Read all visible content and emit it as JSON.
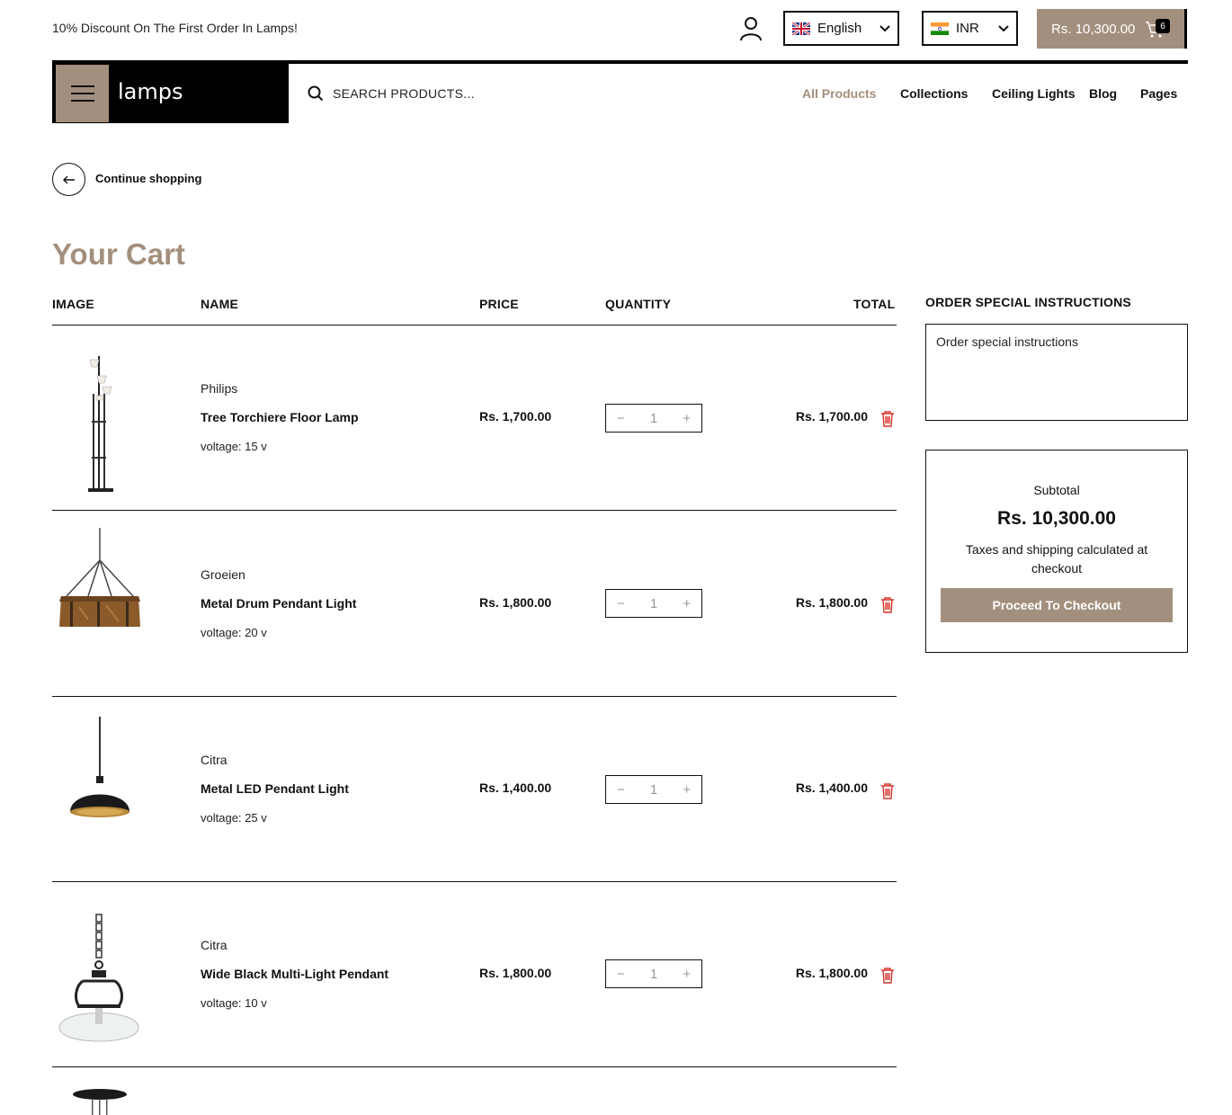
{
  "topbar": {
    "promo": "10% Discount On The First Order In Lamps!",
    "language": "English",
    "currency": "INR",
    "cart_total": "Rs. 10,300.00",
    "cart_count": "6"
  },
  "header": {
    "brand": "lamps",
    "search_placeholder": "SEARCH PRODUCTS...",
    "nav": [
      "All Products",
      "Collections",
      "Ceiling Lights",
      "Blog",
      "Pages"
    ]
  },
  "back_label": "Continue shopping",
  "page_title": "Your Cart",
  "table": {
    "headers": [
      "IMAGE",
      "NAME",
      "PRICE",
      "QUANTITY",
      "TOTAL"
    ],
    "rows": [
      {
        "vendor": "Philips",
        "name": "Tree Torchiere Floor Lamp",
        "option": "voltage:  15 v",
        "price": "Rs. 1,700.00",
        "qty": "1",
        "total": "Rs. 1,700.00"
      },
      {
        "vendor": "Groeien",
        "name": "Metal Drum Pendant Light",
        "option": "voltage:  20 v",
        "price": "Rs. 1,800.00",
        "qty": "1",
        "total": "Rs. 1,800.00"
      },
      {
        "vendor": "Citra",
        "name": "Metal LED Pendant Light",
        "option": "voltage:  25 v",
        "price": "Rs. 1,400.00",
        "qty": "1",
        "total": "Rs. 1,400.00"
      },
      {
        "vendor": "Citra",
        "name": "Wide Black Multi-Light Pendant",
        "option": "voltage:  10 v",
        "price": "Rs. 1,800.00",
        "qty": "1",
        "total": "Rs. 1,800.00"
      }
    ]
  },
  "sidebar": {
    "instructions_title": "ORDER SPECIAL INSTRUCTIONS",
    "instructions_placeholder": "Order special instructions",
    "subtotal_label": "Subtotal",
    "subtotal_value": "Rs. 10,300.00",
    "tax_note": "Taxes and shipping calculated at checkout",
    "checkout_label": "Proceed To Checkout"
  },
  "colors": {
    "accent": "#a38f7d",
    "delete": "#d9352b"
  }
}
